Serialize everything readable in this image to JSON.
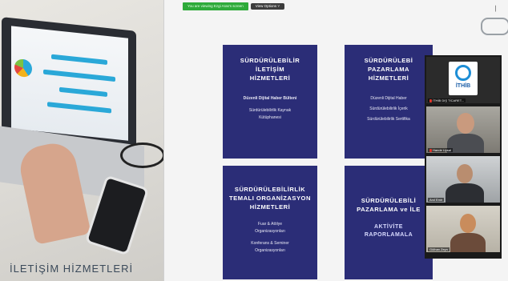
{
  "photo": {
    "caption": "İLETİŞİM HİZMETLERİ"
  },
  "toolbar": {
    "share_status": "You are viewing Ezgi Aras's screen",
    "view_options": "View Options ˅"
  },
  "cards": [
    {
      "title_lines": [
        "SÜRDÜRÜLEBİLİR",
        "İLETİŞİM",
        "HİZMETLERİ"
      ],
      "items": [
        "Düzenli Dijital Haber Bülteni",
        "Sürdürülebilirlik Kaynak",
        "Kütüphanesi"
      ]
    },
    {
      "title_lines": [
        "SÜRDÜRÜLEBİ",
        "PAZARLAMA",
        "HİZMETLERİ"
      ],
      "items": [
        "Düzenli Dijital Haber",
        "Sürdürülebilirlik İçerik",
        "Sürdürülebilirlik Sertifika"
      ]
    },
    {
      "title_lines": [
        "SÜRDÜRÜLEBİLİRLİK",
        "TEMALI ORGANİZASYON",
        "HİZMETLERİ"
      ],
      "items": [
        "Fuar & Atölye",
        "Organizasyonları",
        "Konferans & Seminer",
        "Organizasyonları"
      ]
    },
    {
      "title_lines": [
        "SÜRDÜRÜLEBİLİ",
        "PAZARLAMA ve İLE"
      ],
      "accent_lines": [
        "AKTİVİTE",
        "RAPORLAMALA"
      ]
    }
  ],
  "participants": [
    {
      "name": "İTHİB DIŞ TİCARET...",
      "muted": true,
      "logo_text": "İTHİB"
    },
    {
      "name": "Hande Uysal",
      "muted": true
    },
    {
      "name": "Anıl Emir",
      "muted": false
    },
    {
      "name": "Gülhan Zeyn",
      "muted": false
    }
  ],
  "colors": {
    "card_bg": "#2b2d77",
    "share_green": "#2eaa3a",
    "muted_red": "#e0362b",
    "logo_blue": "#1d8ed6"
  }
}
